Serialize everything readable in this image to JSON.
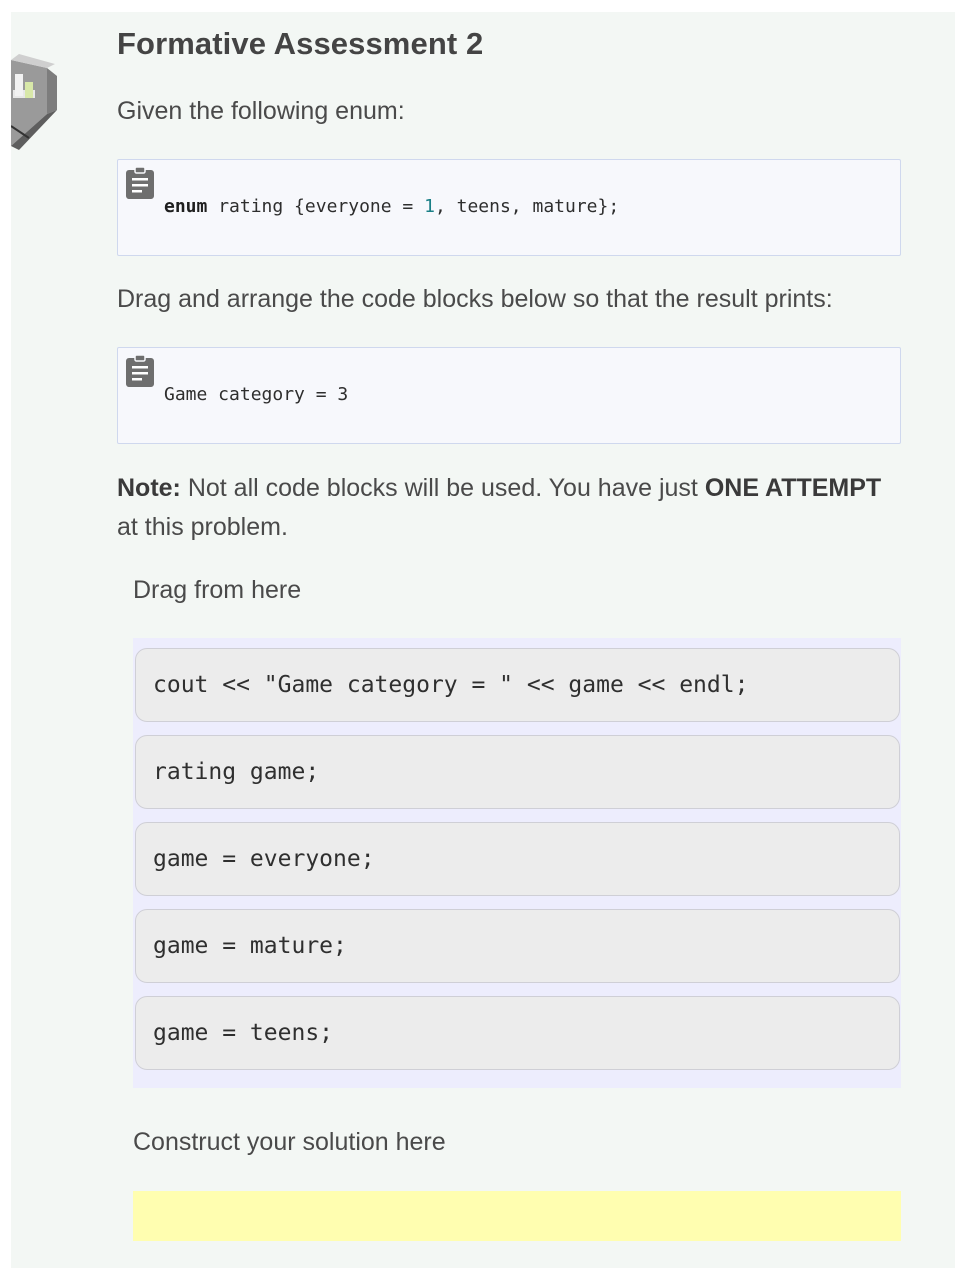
{
  "title": "Formative Assessment 2",
  "intro_text": "Given the following enum:",
  "enum_code": {
    "keyword": "enum",
    "before_num": " rating {everyone = ",
    "num": "1",
    "after_num": ", teens, mature};"
  },
  "instruction_text": "Drag and arrange the code blocks below so that the result prints:",
  "output_code": "Game category = 3",
  "note": {
    "label": "Note:",
    "text_before": " Not all code blocks will be used. You have just ",
    "emphasis": "ONE ATTEMPT",
    "text_after": " at this problem."
  },
  "drag_label": "Drag from here",
  "blocks": [
    "cout << \"Game category = \" << game << endl;",
    "rating game;",
    "game = everyone;",
    "game = mature;",
    "game = teens;"
  ],
  "solution_label": "Construct your solution here",
  "icons": {
    "clipboard": "clipboard-icon",
    "side": "isometric-cube-icon"
  },
  "colors": {
    "page_bg": "#f3f7f4",
    "drag_area_bg": "#ededfd",
    "solution_area_bg": "#fffeb0",
    "code_number": "#1a7f86"
  }
}
